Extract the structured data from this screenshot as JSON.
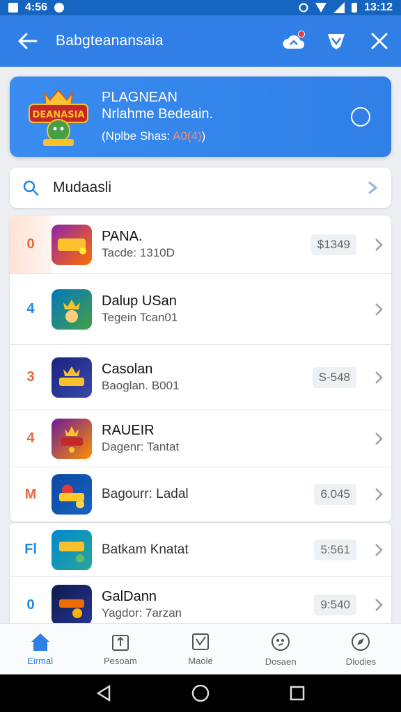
{
  "status_bar": {
    "left_text": "4:56",
    "time": "13:12"
  },
  "app_bar": {
    "title": "Babgteanansaia"
  },
  "banner": {
    "title": "PLAGNEAN",
    "subtitle": "Nrlahme Bedeain.",
    "info_prefix": "Nplbe Shas:",
    "info_highlight": "A0(4)",
    "logo_text": "DEANASIA"
  },
  "search": {
    "query": "Mudaasli"
  },
  "list_items": [
    {
      "rank": "0",
      "rank_color": "#e8683a",
      "name": "PANA.",
      "sub": "Tacde: 1310D",
      "price": "$1349",
      "icon_colors": [
        "#8e24aa",
        "#ff6f00"
      ]
    },
    {
      "rank": "4",
      "rank_color": "#1e88e5",
      "name": "Dalup USan",
      "sub": "Tegein Tcan01",
      "price": "",
      "icon_colors": [
        "#0277bd",
        "#43a047"
      ]
    },
    {
      "rank": "3",
      "rank_color": "#e8683a",
      "name": "Casolan",
      "sub": "Baoglan. B001",
      "price": "S-548",
      "icon_colors": [
        "#1a237e",
        "#fbc02d"
      ]
    },
    {
      "rank": "4",
      "rank_color": "#e8683a",
      "name": "RAUEIR",
      "sub": "Dagenr: Tantat",
      "price": "",
      "icon_colors": [
        "#6a1b9a",
        "#ff8f00"
      ]
    },
    {
      "rank": "M",
      "rank_color": "#e8683a",
      "name": "",
      "sub": "Bagourr: Ladal",
      "price": "6.045",
      "icon_colors": [
        "#0d47a1",
        "#ffca28"
      ]
    }
  ],
  "list_items_2": [
    {
      "rank": "Fl",
      "rank_color": "#1e88e5",
      "name": "",
      "sub": "Batkam Knatat",
      "price": "5:561",
      "icon_colors": [
        "#0288d1",
        "#66bb6a"
      ]
    },
    {
      "rank": "0",
      "rank_color": "#1e88e5",
      "name": "GalDann",
      "sub": "Yagdor: 7arzan",
      "price": "9:540",
      "icon_colors": [
        "#0d1b4c",
        "#e65100"
      ]
    }
  ],
  "bottom_nav": [
    {
      "label": "Eirmal",
      "icon": "home-icon",
      "active": true
    },
    {
      "label": "Pesoam",
      "icon": "upload-icon",
      "active": false
    },
    {
      "label": "Maole",
      "icon": "check-box-icon",
      "active": false
    },
    {
      "label": "Dosaen",
      "icon": "chat-icon",
      "active": false
    },
    {
      "label": "Dlodies",
      "icon": "compass-icon",
      "active": false
    }
  ],
  "colors": {
    "primary": "#2f7fe6",
    "status_bar": "#1565c0",
    "accent_orange": "#e8683a"
  }
}
